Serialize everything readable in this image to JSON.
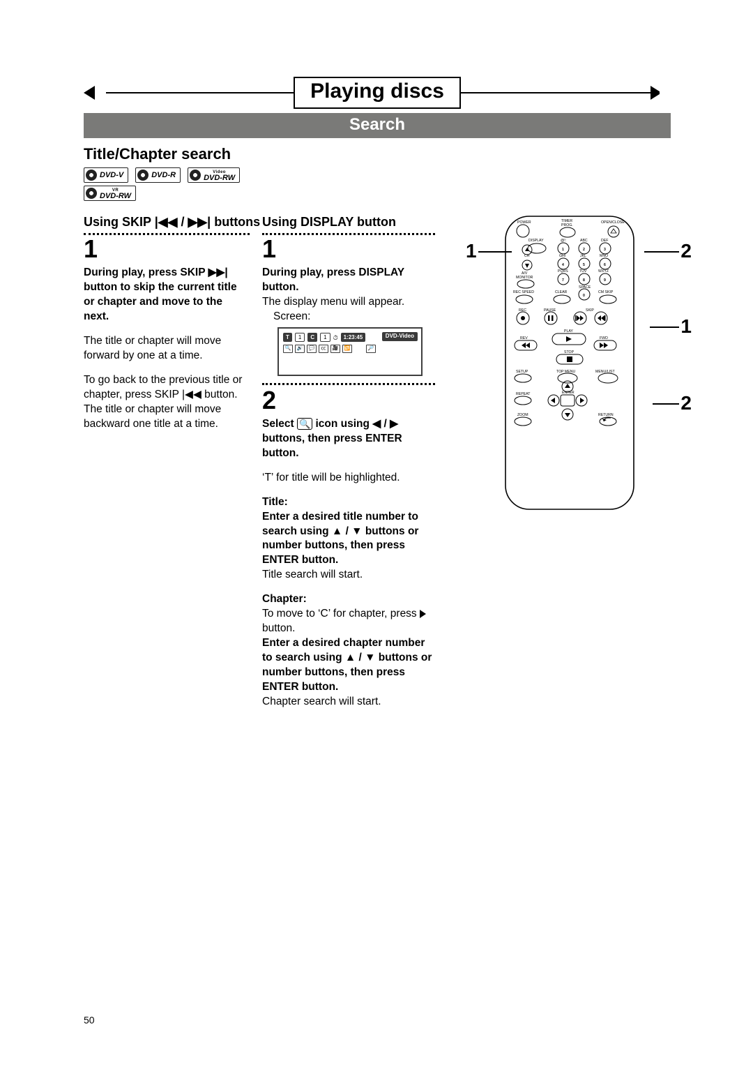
{
  "header": {
    "chapter_title": "Playing discs",
    "section_title": "Search"
  },
  "section_heading": "Title/Chapter search",
  "badges": {
    "row1": [
      "DVD-V",
      "DVD-R",
      "DVD-RW"
    ],
    "row1_super": [
      "",
      "",
      "Video"
    ],
    "row2": [
      "DVD-RW"
    ],
    "row2_super": [
      "VR"
    ]
  },
  "col1": {
    "method_title_prefix": "Using SKIP",
    "method_title_suffix": " buttons",
    "step1_num": "1",
    "step1_bold": "During play, press SKIP ▶▶| button to skip the current title or chapter and move to the next.",
    "step1_text1": "The title or chapter will move forward by one at a time.",
    "step1_text2": "To go back to the previous title or chapter, press SKIP |◀◀ button. The title or chapter will move backward one title at a time."
  },
  "col2": {
    "method_title": "Using DISPLAY button",
    "s1_num": "1",
    "s1_bold": "During play, press DISPLAY button.",
    "s1_text": "The display menu will appear.",
    "s1_screen_label": "Screen:",
    "screen": {
      "t_label": "T",
      "t_val": "1",
      "c_label": "C",
      "c_val": "1",
      "clock": "⏱",
      "time": "1:23:45",
      "tag": "DVD-Video"
    },
    "s2_num": "2",
    "s2_bold_a": "Select ",
    "s2_bold_b": " icon using ◀ / ▶ buttons, then press ENTER button.",
    "s2_text": "‘T’ for title will be highlighted.",
    "title_label": "Title:",
    "title_bold": "Enter a desired title number to search using ▲ / ▼ buttons or number buttons, then press ENTER button.",
    "title_text": "Title search will start.",
    "chapter_label": "Chapter:",
    "chapter_text1": "To move to ‘C’ for chapter, press ▶ button.",
    "chapter_bold": "Enter a desired chapter number to search using ▲ / ▼ buttons or number buttons, then press ENTER button.",
    "chapter_text2": "Chapter search will start."
  },
  "remote": {
    "labels": {
      "power": "POWER",
      "open_close": "OPEN/CLOSE",
      "timer_prog": "TIMER\nPROG.",
      "display": "DISPLAY",
      "ch": "CH",
      "av_monitor": "A/V\nMONITOR",
      "abc": "ABC",
      "def": "DEF",
      "ghi": "GHI",
      "jkl": "JKL",
      "mno": "MNO",
      "pqrs": "PQRS",
      "tuv": "TUV",
      "wxyz": "WXYZ",
      "rec_speed": "REC SPEED",
      "clear": "CLEAR",
      "space": "SPACE",
      "cm_skip": "CM SKIP",
      "rec": "REC",
      "pause": "PAUSE",
      "skip": "SKIP",
      "play": "PLAY",
      "rev": "REV",
      "fwd": "FWD",
      "stop": "STOP",
      "setup": "SETUP",
      "top_menu": "TOP MENU",
      "menu_list": "MENU/LIST",
      "repeat": "REPEAT",
      "enter": "ENTER",
      "zoom": "ZOOM",
      "return": "RETURN"
    },
    "nums": [
      "1",
      "2",
      "3",
      "4",
      "5",
      "6",
      "7",
      "8",
      "9",
      "0",
      "@!"
    ],
    "callouts": {
      "top_left": "1",
      "top_right": "2",
      "mid_right": "1",
      "bot_right": "2"
    }
  },
  "page_number": "50"
}
